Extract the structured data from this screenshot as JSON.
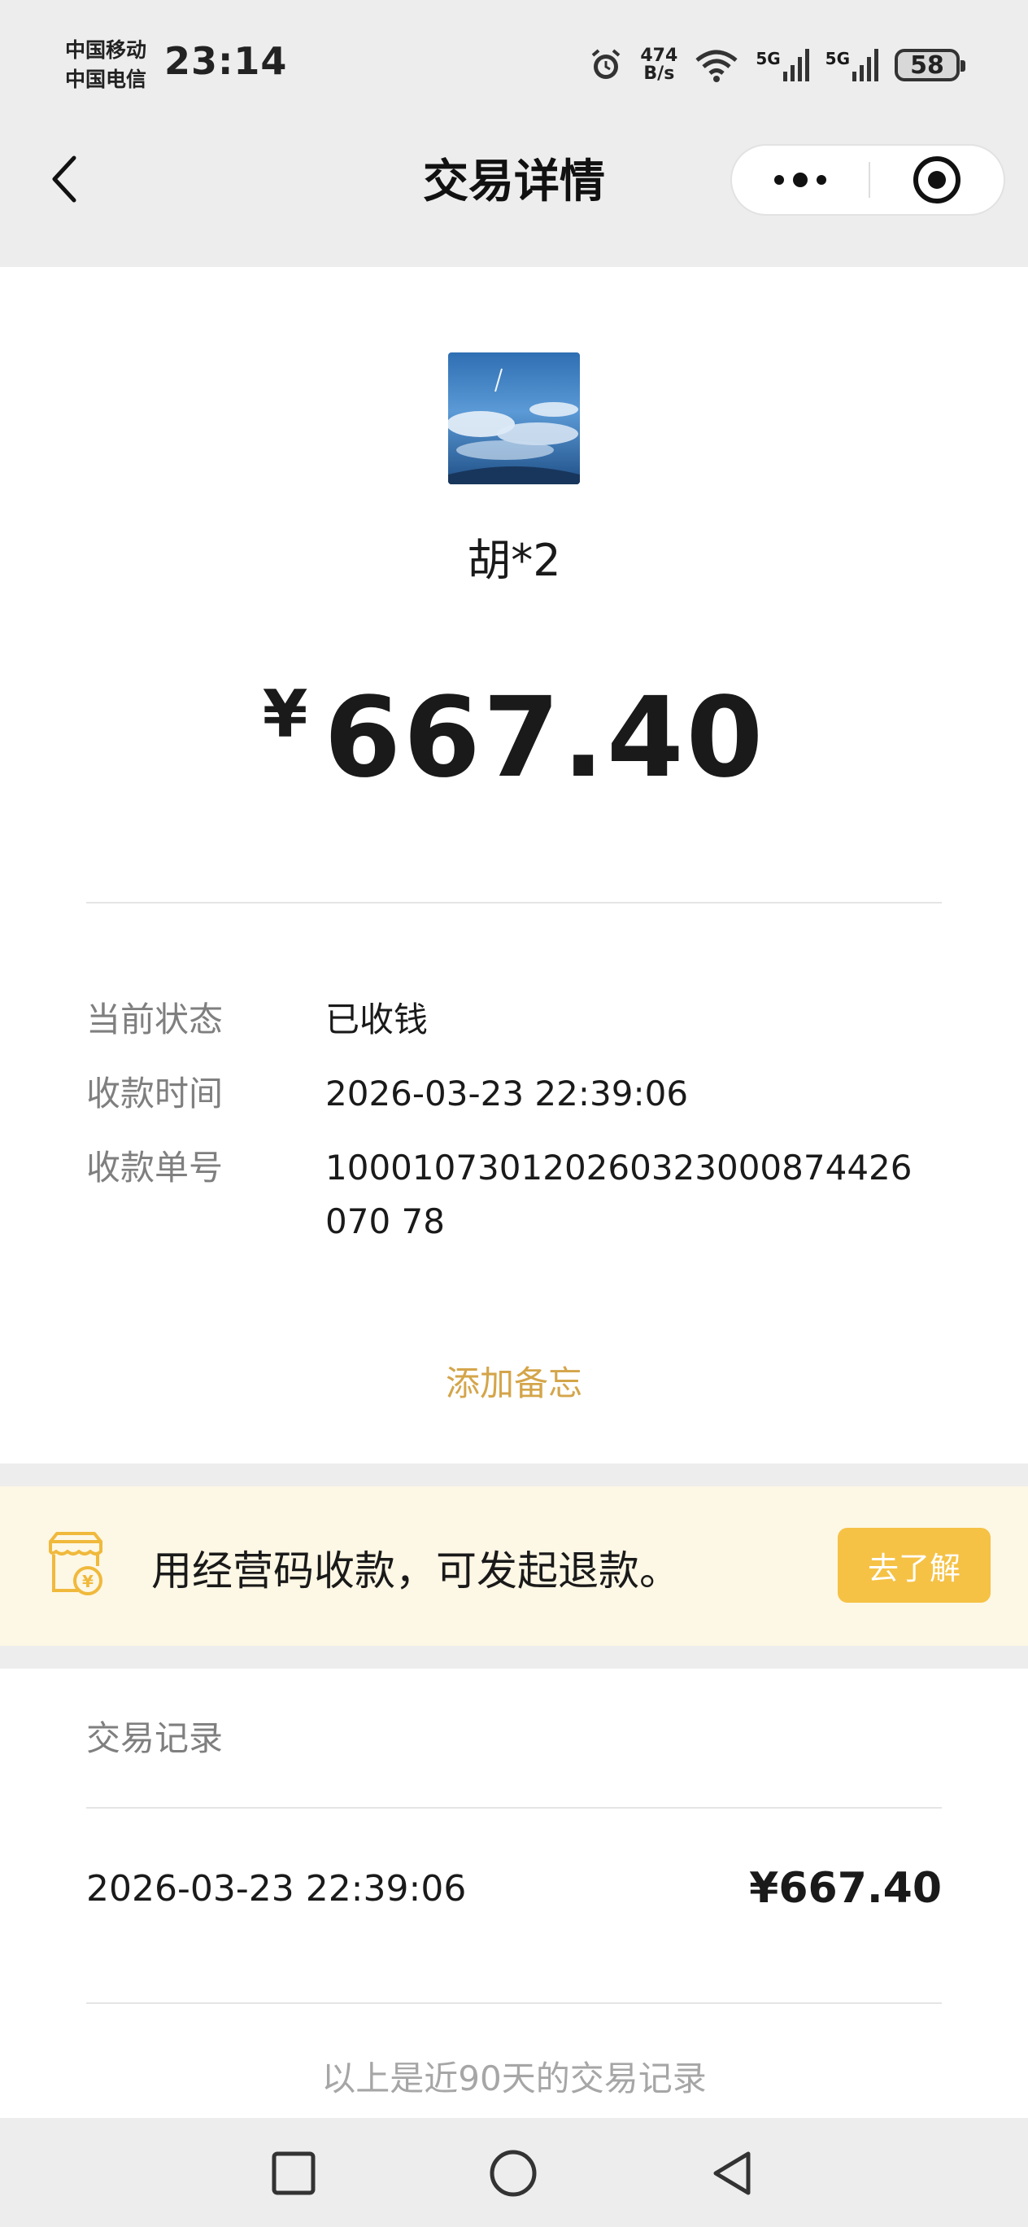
{
  "status_bar": {
    "carrier_1": "中国移动",
    "carrier_2": "中国电信",
    "time": "23:14",
    "net_speed_value": "474",
    "net_speed_unit": "B/s",
    "signal_1_label": "5G",
    "signal_2_label": "5G",
    "battery": "58",
    "icons": [
      "alarm-icon",
      "wifi-icon",
      "signal-icon",
      "battery-icon"
    ]
  },
  "nav": {
    "title": "交易详情",
    "icons": [
      "chevron-left-icon",
      "more-icon",
      "target-icon"
    ]
  },
  "transaction": {
    "payer_name": "胡*2",
    "currency_symbol": "¥",
    "amount": "667.40",
    "details": [
      {
        "label": "当前状态",
        "value": "已收钱"
      },
      {
        "label": "收款时间",
        "value": "2026-03-23 22:39:06"
      },
      {
        "label": "收款单号",
        "value": "100010730120260323000874426070 78"
      }
    ],
    "add_note": "添加备忘"
  },
  "banner": {
    "text": "用经营码收款，可发起退款。",
    "button": "去了解",
    "icon": "store-yen-icon"
  },
  "records": {
    "title": "交易记录",
    "items": [
      {
        "time": "2026-03-23 22:39:06",
        "amount": "¥667.40"
      }
    ],
    "footer": "以上是近90天的交易记录"
  },
  "system_nav": {
    "icons": [
      "recent-apps-icon",
      "home-icon",
      "back-triangle-icon"
    ]
  },
  "colors": {
    "accent_gold": "#d4a54a",
    "banner_bg": "#fdf7e5",
    "banner_button": "#f5c245",
    "page_bg": "#ededed"
  }
}
